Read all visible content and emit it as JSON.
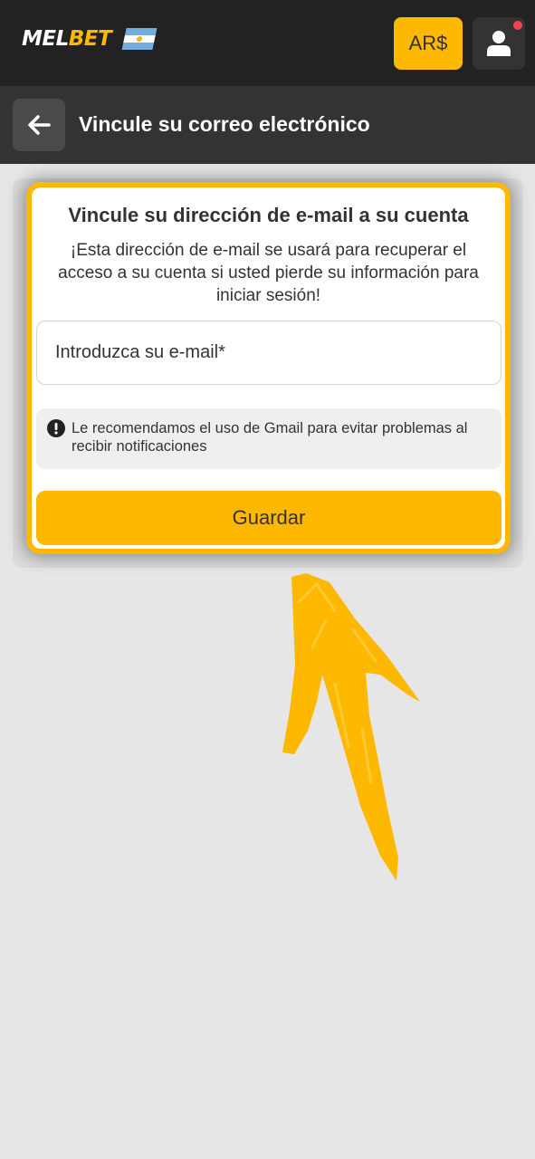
{
  "header": {
    "logo": {
      "part1": "MEL",
      "part2": "BET",
      "flag_icon": "argentina-flag-icon"
    },
    "currency_label": "AR$",
    "user_icon": "user-icon",
    "notification_color": "#f4404a"
  },
  "subheader": {
    "back_icon": "arrow-left-icon",
    "title": "Vincule su correo electrónico"
  },
  "card": {
    "title": "Vincule su dirección de e-mail a su cuenta",
    "description": "¡Esta dirección de e-mail se usará para recuperar el acceso a su cuenta si usted pierde su información para iniciar sesión!",
    "email_placeholder": "Introduzca su e-mail*",
    "notice_icon": "exclamation-circle-icon",
    "notice_text": "Le recomendamos el uso de Gmail para evitar problemas al recibir notificaciones",
    "save_label": "Guardar"
  },
  "overlay": {
    "arrow_icon": "hand-drawn-arrow-up-icon"
  },
  "colors": {
    "accent": "#ffb800",
    "topbar": "#222222",
    "subbar": "#333333",
    "background": "#e6e6e6"
  }
}
